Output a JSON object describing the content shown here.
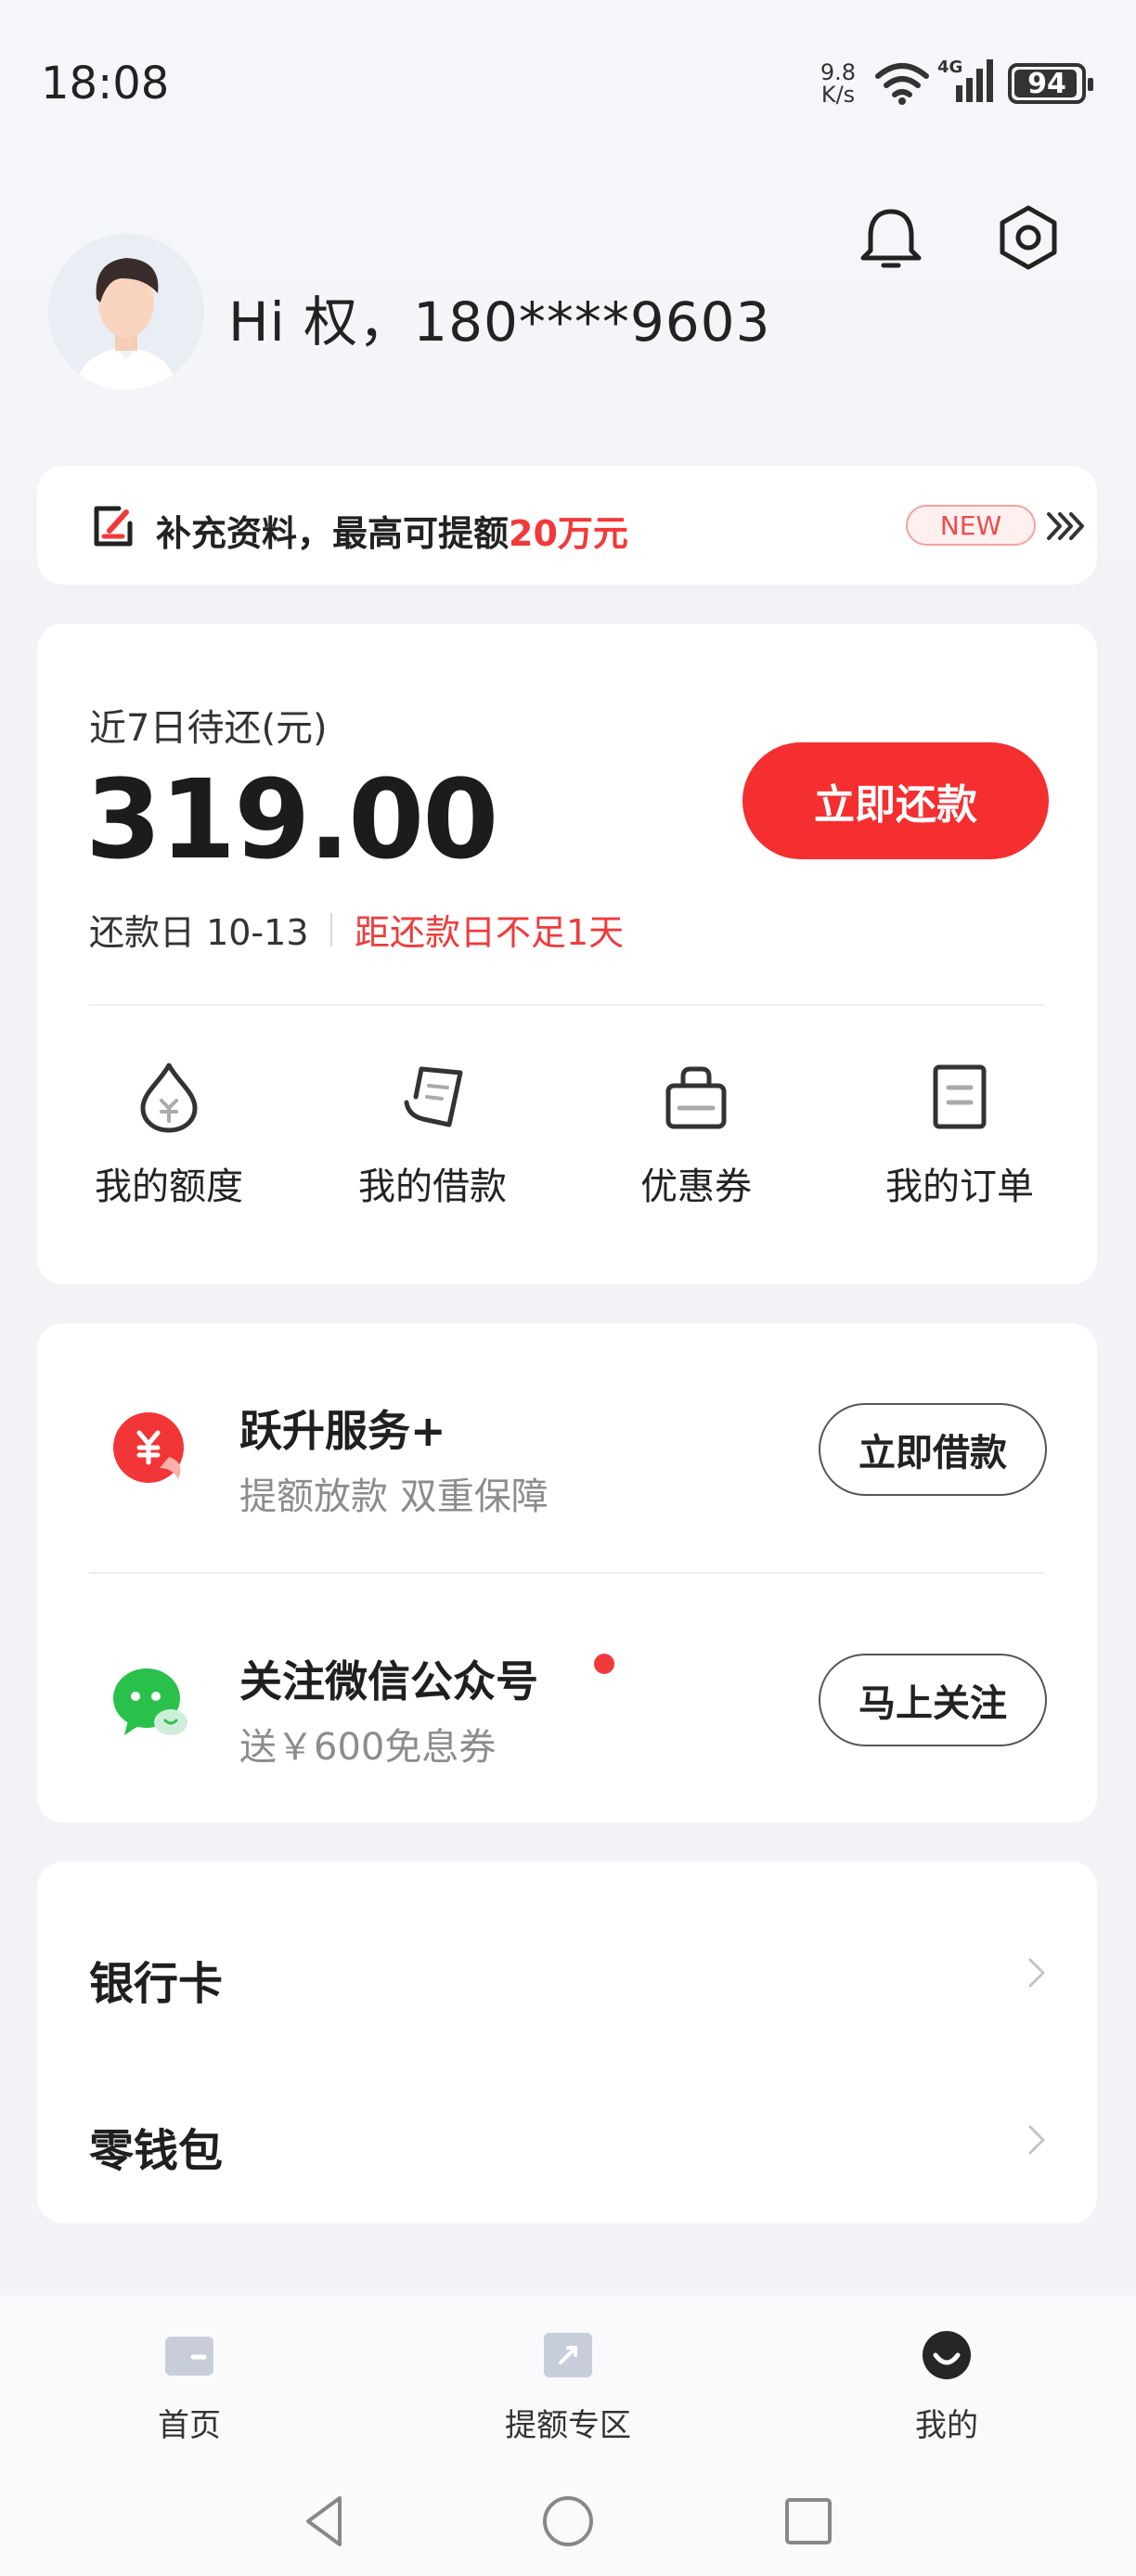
{
  "status_bar": {
    "time": "18:08",
    "net_speed_value": "9.8",
    "net_speed_unit": "K/s",
    "network_type": "4G",
    "battery": "94"
  },
  "header": {
    "greeting": "Hi 权，180****9603"
  },
  "promo": {
    "text": "补充资料，最高可提额",
    "highlight": "20万元",
    "badge": "NEW"
  },
  "repay": {
    "label": "近7日待还(元)",
    "amount": "319.00",
    "due_date": "还款日 10-13",
    "warning": "距还款日不足1天",
    "button": "立即还款"
  },
  "quick_actions": [
    {
      "label": "我的额度",
      "icon": "quota-icon"
    },
    {
      "label": "我的借款",
      "icon": "loan-icon"
    },
    {
      "label": "优惠券",
      "icon": "coupon-icon"
    },
    {
      "label": "我的订单",
      "icon": "order-icon"
    }
  ],
  "services": [
    {
      "title": "跃升服务+",
      "subtitle": "提额放款 双重保障",
      "button": "立即借款",
      "icon": "yuan-badge-icon"
    },
    {
      "title": "关注微信公众号",
      "subtitle": "送￥600免息券",
      "button": "马上关注",
      "icon": "wechat-icon"
    }
  ],
  "list": [
    {
      "label": "银行卡"
    },
    {
      "label": "零钱包"
    }
  ],
  "bottom_nav": [
    {
      "label": "首页",
      "icon": "home-icon"
    },
    {
      "label": "提额专区",
      "icon": "boost-icon"
    },
    {
      "label": "我的",
      "icon": "profile-icon",
      "active": true
    }
  ],
  "colors": {
    "accent": "#f52e30",
    "warning": "#ef3b3b",
    "background": "#f3f3f7"
  }
}
